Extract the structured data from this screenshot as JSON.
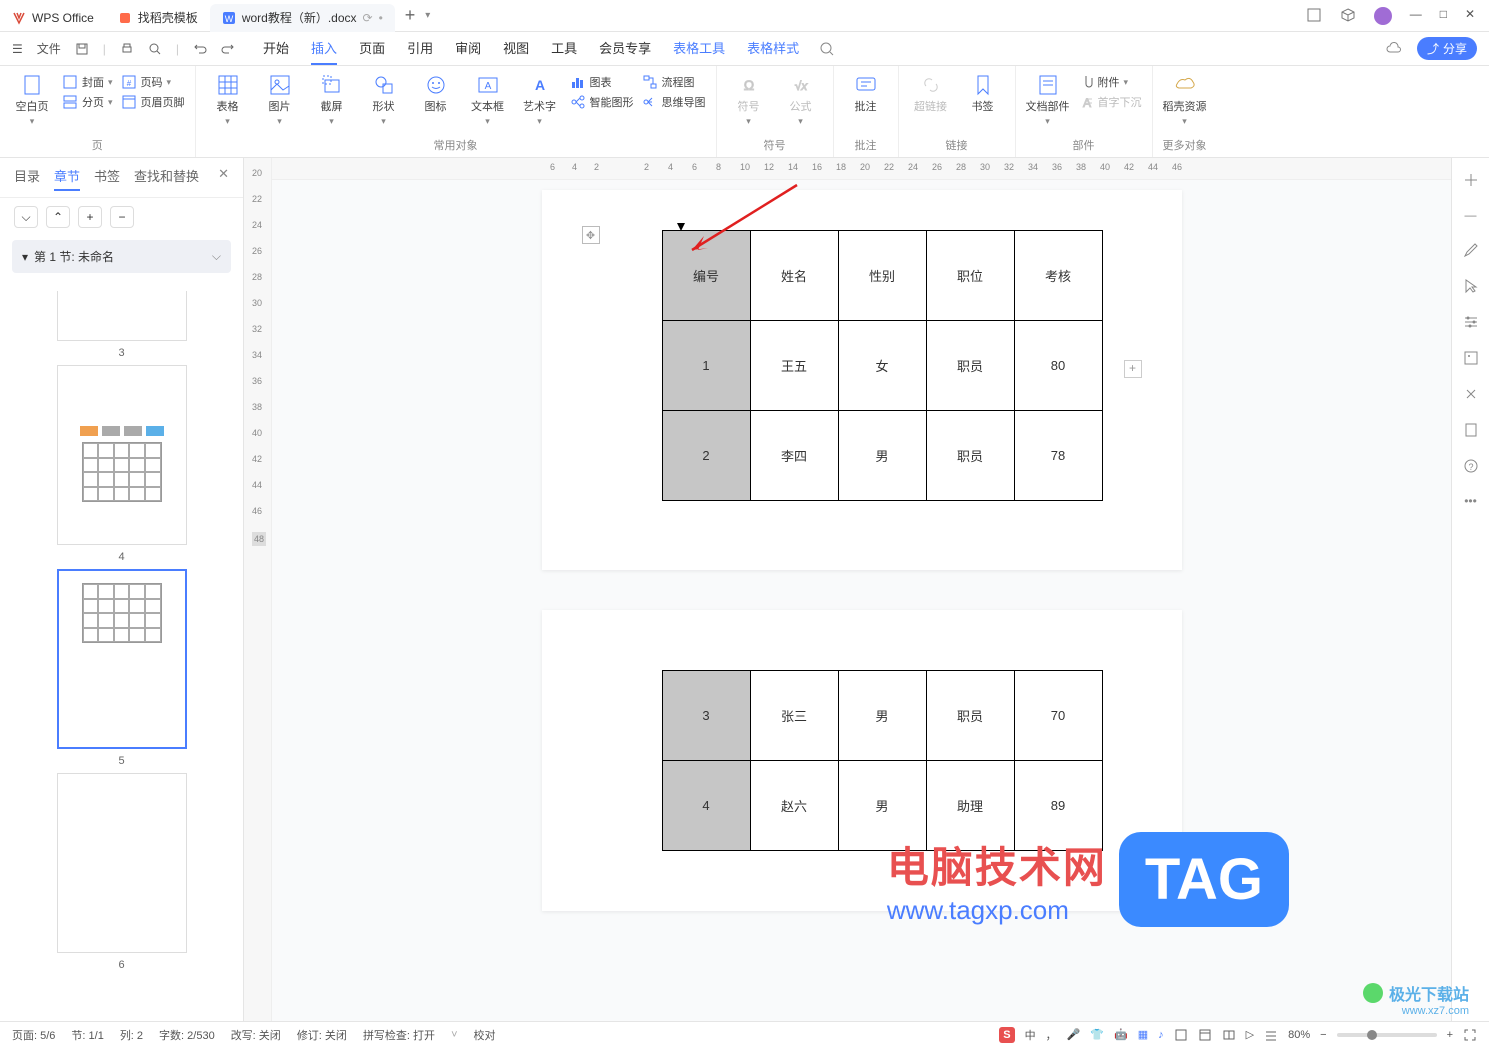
{
  "titlebar": {
    "app": "WPS Office",
    "tab1": "找稻壳模板",
    "tab2": "word教程（新）.docx",
    "newtab": "+",
    "win": {
      "min": "—",
      "max": "□",
      "close": "✕"
    }
  },
  "menubar": {
    "file": "文件",
    "tabs": [
      "开始",
      "插入",
      "页面",
      "引用",
      "审阅",
      "视图",
      "工具",
      "会员专享",
      "表格工具",
      "表格样式"
    ],
    "share": "分享"
  },
  "ribbon": {
    "group_page": {
      "label": "页",
      "blank": "空白页",
      "cover": "封面",
      "pagebreak": "分页",
      "pagenum": "页码",
      "headerfooter": "页眉页脚"
    },
    "group_common": {
      "label": "常用对象",
      "table": "表格",
      "picture": "图片",
      "screenshot": "截屏",
      "shape": "形状",
      "icon": "图标",
      "textbox": "文本框",
      "wordart": "艺术字",
      "chart": "图表",
      "smartart": "智能图形",
      "flow": "流程图",
      "mindmap": "思维导图"
    },
    "group_symbol": {
      "label": "符号",
      "symbol": "符号",
      "formula": "公式"
    },
    "group_comment": {
      "label": "批注",
      "comment": "批注"
    },
    "group_link": {
      "label": "链接",
      "hyperlink": "超链接",
      "bookmark": "书签"
    },
    "group_part": {
      "label": "部件",
      "docpart": "文档部件",
      "attach": "附件",
      "dropcap": "首字下沉"
    },
    "group_more": {
      "label": "更多对象",
      "resource": "稻壳资源"
    }
  },
  "sidebar": {
    "tabs": [
      "目录",
      "章节",
      "书签",
      "查找和替换"
    ],
    "section": "第 1 节: 未命名",
    "thumbs": [
      "3",
      "4",
      "5",
      "6"
    ]
  },
  "vruler": [
    "20",
    "22",
    "24",
    "26",
    "28",
    "30",
    "32",
    "34",
    "36",
    "38",
    "40",
    "42",
    "44",
    "46",
    "48"
  ],
  "hruler_left": [
    "6",
    "4",
    "2"
  ],
  "hruler_right": [
    "2",
    "4",
    "6",
    "8",
    "10",
    "12",
    "14",
    "16",
    "18",
    "20",
    "22",
    "24",
    "26",
    "28",
    "30",
    "32",
    "34",
    "36",
    "38",
    "40",
    "42",
    "44",
    "46"
  ],
  "table1": {
    "header": [
      "编号",
      "姓名",
      "性别",
      "职位",
      "考核"
    ],
    "rows": [
      [
        "1",
        "王五",
        "女",
        "职员",
        "80"
      ],
      [
        "2",
        "李四",
        "男",
        "职员",
        "78"
      ]
    ]
  },
  "table2": {
    "rows": [
      [
        "3",
        "张三",
        "男",
        "职员",
        "70"
      ],
      [
        "4",
        "赵六",
        "男",
        "助理",
        "89"
      ]
    ]
  },
  "watermark": {
    "label": "TAG",
    "line1": "电脑技术网",
    "line2": "www.tagxp.com",
    "brand": "极光下载站",
    "brandurl": "www.xz7.com"
  },
  "status": {
    "page": "页面: 5/6",
    "sec": "节: 1/1",
    "col": "列: 2",
    "words": "字数: 2/530",
    "track": "改写: 关闭",
    "rev": "修订: 关闭",
    "spell": "拼写检查: 打开",
    "proof": "校对",
    "lang": "中",
    "zoom": "80%"
  }
}
